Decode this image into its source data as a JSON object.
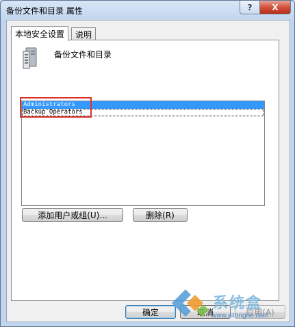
{
  "window": {
    "title": "备份文件和目录 属性",
    "help_button": "?",
    "close_button": "X"
  },
  "tabs": [
    {
      "label": "本地安全设置",
      "active": true
    },
    {
      "label": "说明",
      "active": false
    }
  ],
  "policy": {
    "name": "备份文件和目录",
    "icon": "server-icon"
  },
  "members": {
    "items": [
      {
        "label": "Administrators",
        "selected": true
      },
      {
        "label": "Backup Operators",
        "selected": false
      }
    ]
  },
  "buttons": {
    "add": "添加用户或组(U)...",
    "remove": "删除(R)",
    "ok": "确定",
    "cancel": "取消",
    "apply": "应用(A)"
  },
  "watermark": {
    "name": "系统盒",
    "url": "www.xitonghe.com"
  },
  "colors": {
    "selection": "#3399ff",
    "highlight_box": "#d9332b",
    "close_button": "#c8412c"
  }
}
